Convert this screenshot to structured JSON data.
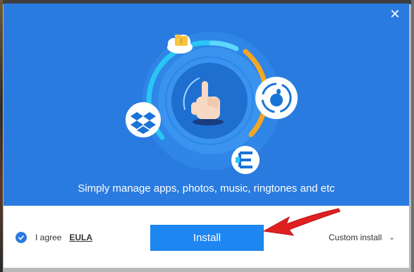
{
  "window": {
    "close_glyph": "✕"
  },
  "hero": {
    "tagline": "Simply manage apps, photos, music, ringtones and etc",
    "icons": [
      "cloud-folder-icon",
      "dropbox-icon",
      "apple-sync-icon",
      "eula-e-icon",
      "hand-touch-icon"
    ]
  },
  "footer": {
    "agree_label": "I agree",
    "eula_link": "EULA",
    "install_label": "Install",
    "custom_install_label": "Custom install",
    "chevron_glyph": "⌄"
  },
  "colors": {
    "hero_background": "#2a7be0",
    "install_button": "#1e86f0",
    "accent_orange": "#f5a623",
    "accent_cyan": "#29c5f6",
    "annotation_arrow": "#e02020"
  }
}
